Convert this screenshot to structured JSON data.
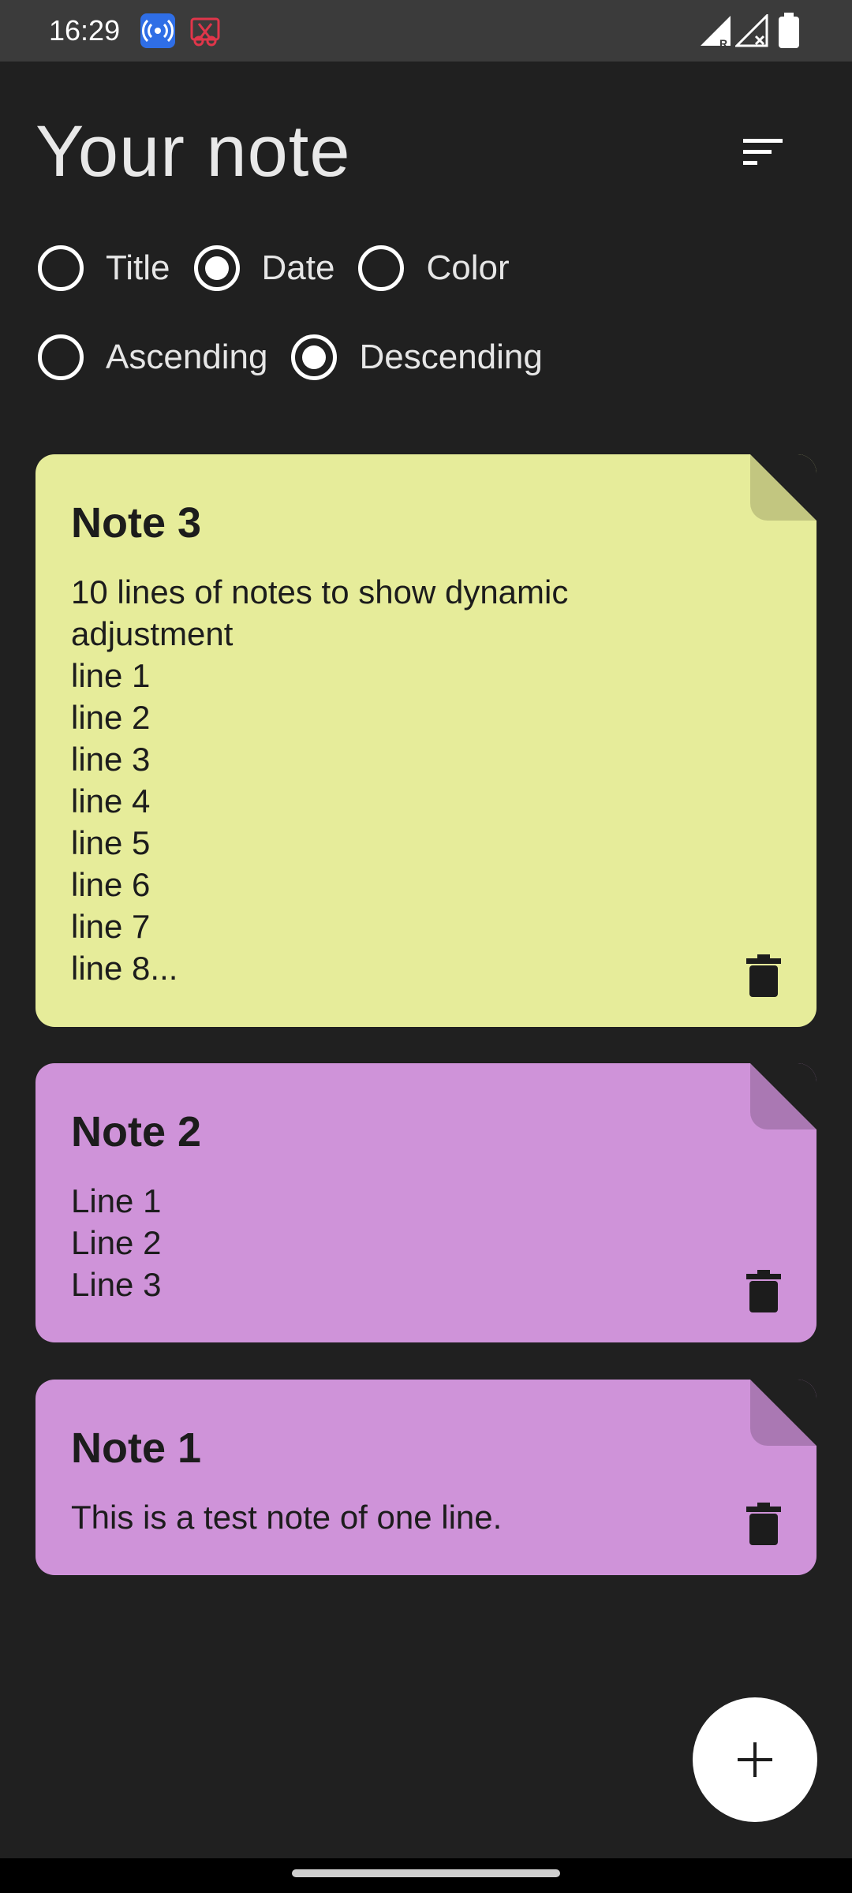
{
  "status_bar": {
    "time": "16:29"
  },
  "header": {
    "title": "Your note"
  },
  "sort": {
    "order_by": [
      {
        "label": "Title",
        "selected": false
      },
      {
        "label": "Date",
        "selected": true
      },
      {
        "label": "Color",
        "selected": false
      }
    ],
    "direction": [
      {
        "label": "Ascending",
        "selected": false
      },
      {
        "label": "Descending",
        "selected": true
      }
    ]
  },
  "notes": [
    {
      "title": "Note 3",
      "body": "10 lines of notes to show dynamic\nadjustment\nline 1\nline 2\nline 3\nline 4\nline 5\nline 6\nline 7\nline 8...",
      "color": "#e6ec9a",
      "fold_color": "#c2c680"
    },
    {
      "title": "Note 2",
      "body": "Line 1\nLine 2\nLine 3",
      "color": "#cf93d9",
      "fold_color": "#aa78b3"
    },
    {
      "title": "Note 1",
      "body": "This is a test note of one line.",
      "color": "#cf93d9",
      "fold_color": "#aa78b3"
    }
  ],
  "icons": {
    "sort": "sort-icon",
    "delete": "trash-icon",
    "add": "plus-icon"
  }
}
